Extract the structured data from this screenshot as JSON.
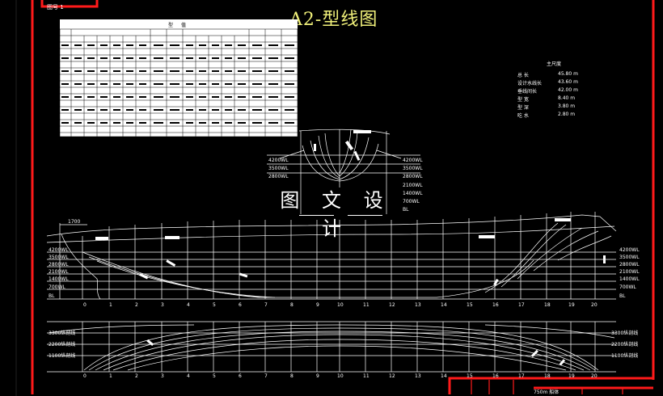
{
  "sheet": {
    "title": "A2-型线图",
    "tab_label": "图号 1",
    "watermark": "图 文 设 计",
    "scale_label": "750m 船体",
    "table_title": "型 值"
  },
  "particulars": {
    "heading": "主尺度",
    "rows": [
      {
        "label": "总 长",
        "value": "45.80 m"
      },
      {
        "label": "设计水线长",
        "value": "43.60 m"
      },
      {
        "label": "垂线间长",
        "value": "42.00 m"
      },
      {
        "label": "型 宽",
        "value": "8.40 m"
      },
      {
        "label": "型 深",
        "value": "3.80 m"
      },
      {
        "label": "吃 水",
        "value": "2.80 m"
      }
    ]
  },
  "profile_labels": {
    "left_waterlines": [
      "4200WL",
      "3500WL",
      "2800WL",
      "2100WL",
      "1400WL",
      "700WL",
      "BL"
    ],
    "right_waterlines": [
      "4200WL",
      "3500WL",
      "2800WL",
      "2100WL",
      "1400WL",
      "700WL",
      "BL"
    ],
    "body_waterlines": [
      "4200WL",
      "3500WL",
      "2800WL",
      "2100WL",
      "1400WL",
      "700WL",
      "BL"
    ],
    "stations": [
      "0",
      "1",
      "2",
      "3",
      "4",
      "5",
      "6",
      "7",
      "8",
      "9",
      "10",
      "11",
      "12",
      "13",
      "14",
      "15",
      "16",
      "17",
      "18",
      "19",
      "20"
    ],
    "deck_marker": "1700",
    "plan_left": [
      "3300纵剖线",
      "2200纵剖线",
      "1100纵剖线"
    ],
    "plan_right": [
      "3300纵剖线",
      "2200纵剖线",
      "1100纵剖线"
    ]
  },
  "colors": {
    "frame": "#ff1a1a",
    "title": "#f0f07a",
    "lines": "#ffffff"
  }
}
